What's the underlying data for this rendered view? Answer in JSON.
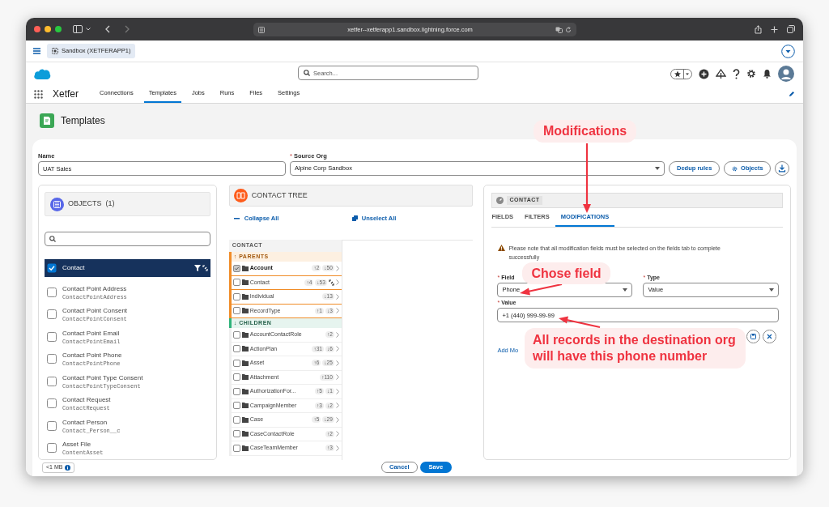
{
  "browser": {
    "url": "xetfer--xetferapp1.sandbox.lightning.force.com"
  },
  "org_bar": {
    "label": "Sandbox (XETFERAPP1)"
  },
  "header": {
    "search_placeholder": "Search..."
  },
  "app": {
    "name": "Xetfer",
    "nav": [
      {
        "label": "Connections",
        "selected": false
      },
      {
        "label": "Templates",
        "selected": true
      },
      {
        "label": "Jobs",
        "selected": false
      },
      {
        "label": "Runs",
        "selected": false
      },
      {
        "label": "Files",
        "selected": false
      },
      {
        "label": "Settings",
        "selected": false
      }
    ]
  },
  "page": {
    "title": "Templates"
  },
  "form": {
    "name": {
      "label": "Name",
      "value": "UAT Sales"
    },
    "source": {
      "label": "Source Org",
      "mark": "*",
      "value": "Alpine Corp Sandbox"
    },
    "buttons": [
      "Dedup rules",
      "Objects"
    ]
  },
  "objects_panel": {
    "title": "OBJECTS",
    "count": "(1)",
    "items": [
      {
        "label": "Contact",
        "checked": true,
        "selected": true
      },
      {
        "label": "Contact Point Address",
        "api": "ContactPointAddress",
        "checked": false,
        "selected": false
      },
      {
        "label": "Contact Point Consent",
        "api": "ContactPointConsent",
        "checked": false,
        "selected": false
      },
      {
        "label": "Contact Point Email",
        "api": "ContactPointEmail",
        "checked": false,
        "selected": false
      },
      {
        "label": "Contact Point Phone",
        "api": "ContactPointPhone",
        "checked": false,
        "selected": false
      },
      {
        "label": "Contact Point Type Consent",
        "api": "ContactPointTypeConsent",
        "checked": false,
        "selected": false
      },
      {
        "label": "Contact Request",
        "api": "ContactRequest",
        "checked": false,
        "selected": false
      },
      {
        "label": "Contact Person",
        "api": "Contact_Person__c",
        "checked": false,
        "selected": false
      },
      {
        "label": "Asset File",
        "api": "ContentAsset",
        "checked": false,
        "selected": false
      }
    ]
  },
  "tree_panel": {
    "title": "CONTACT TREE",
    "collapse": "Collapse All",
    "unselect": "Unselect All",
    "root": "CONTACT",
    "groups": [
      {
        "kind": "parents",
        "label": "↑ PARENTS",
        "rows": [
          {
            "name": "Account",
            "up": "↑2",
            "down": "↓50",
            "checked": true,
            "linked": false
          },
          {
            "name": "Contact",
            "up": "↑4",
            "down": "↓53",
            "checked": false,
            "linked": true
          },
          {
            "name": "Individual",
            "down": "↓13",
            "checked": false,
            "linked": false
          },
          {
            "name": "RecordType",
            "up": "↑1",
            "down": "↓3",
            "checked": false,
            "linked": false
          }
        ]
      },
      {
        "kind": "children",
        "label": "↓ CHILDREN",
        "rows": [
          {
            "name": "AccountContactRole",
            "up": "↑2",
            "checked": false,
            "linked": false
          },
          {
            "name": "ActionPlan",
            "up": "↑31",
            "down": "↓6",
            "checked": false,
            "linked": false
          },
          {
            "name": "Asset",
            "up": "↑6",
            "down": "↓25",
            "checked": false,
            "linked": false
          },
          {
            "name": "Attachment",
            "up": "↑110",
            "checked": false,
            "linked": false
          },
          {
            "name": "AuthorizationFor...",
            "up": "↑5",
            "down": "↓1",
            "checked": false,
            "linked": false
          },
          {
            "name": "CampaignMember",
            "up": "↑3",
            "down": "↓2",
            "checked": false,
            "linked": false
          },
          {
            "name": "Case",
            "up": "↑5",
            "down": "↓29",
            "checked": false,
            "linked": false
          },
          {
            "name": "CaseContactRole",
            "up": "↑2",
            "checked": false,
            "linked": false
          },
          {
            "name": "CaseTeamMember",
            "up": "↑3",
            "checked": false,
            "linked": false
          }
        ]
      }
    ]
  },
  "detail_panel": {
    "object": "CONTACT",
    "tabs": [
      {
        "label": "FIELDS",
        "selected": false
      },
      {
        "label": "FILTERS",
        "selected": false
      },
      {
        "label": "MODIFICATIONS",
        "selected": true
      }
    ],
    "warning": "Please note that all modification fields must be selected on the fields tab to complete successfully",
    "field": {
      "label": "Field",
      "mark": "*",
      "value": "Phone"
    },
    "type": {
      "label": "Type",
      "mark": "*",
      "value": "Value"
    },
    "value": {
      "label": "Value",
      "mark": "*",
      "value": "+1 (440) 999-99-99"
    },
    "add_link": "Add Mo"
  },
  "footer": {
    "size": "<1 MB",
    "cancel": "Cancel",
    "save": "Save"
  },
  "annotations": [
    {
      "kind": "tab",
      "text": "Modifications"
    },
    {
      "kind": "field",
      "text": "Chose field"
    },
    {
      "kind": "value",
      "text": "All records in the destination org will have this phone number"
    }
  ]
}
